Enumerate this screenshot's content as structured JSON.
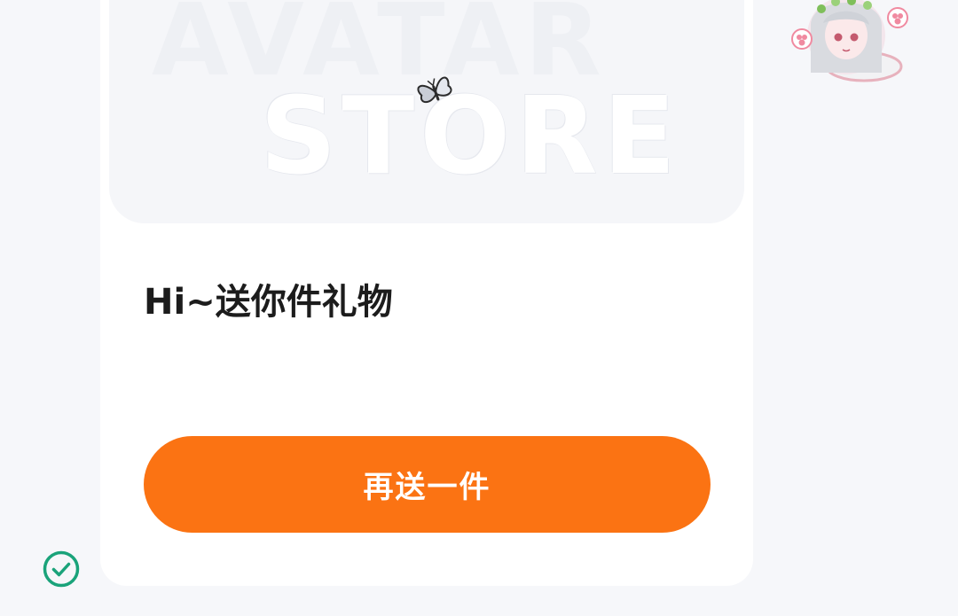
{
  "banner": {
    "watermark_line1": "AVATAR",
    "watermark_line2": "STORE",
    "decoration": "butterfly-icon"
  },
  "gift": {
    "title": "Hi~送你件礼物",
    "resend_label": "再送一件"
  },
  "colors": {
    "accent": "#fb7313",
    "status_ok": "#1aa37a",
    "page_bg": "#f6f7fa",
    "card_bg": "#ffffff"
  },
  "icons": {
    "avatar": "anime-girl-avatar-sticker",
    "status": "check-circle-icon"
  }
}
